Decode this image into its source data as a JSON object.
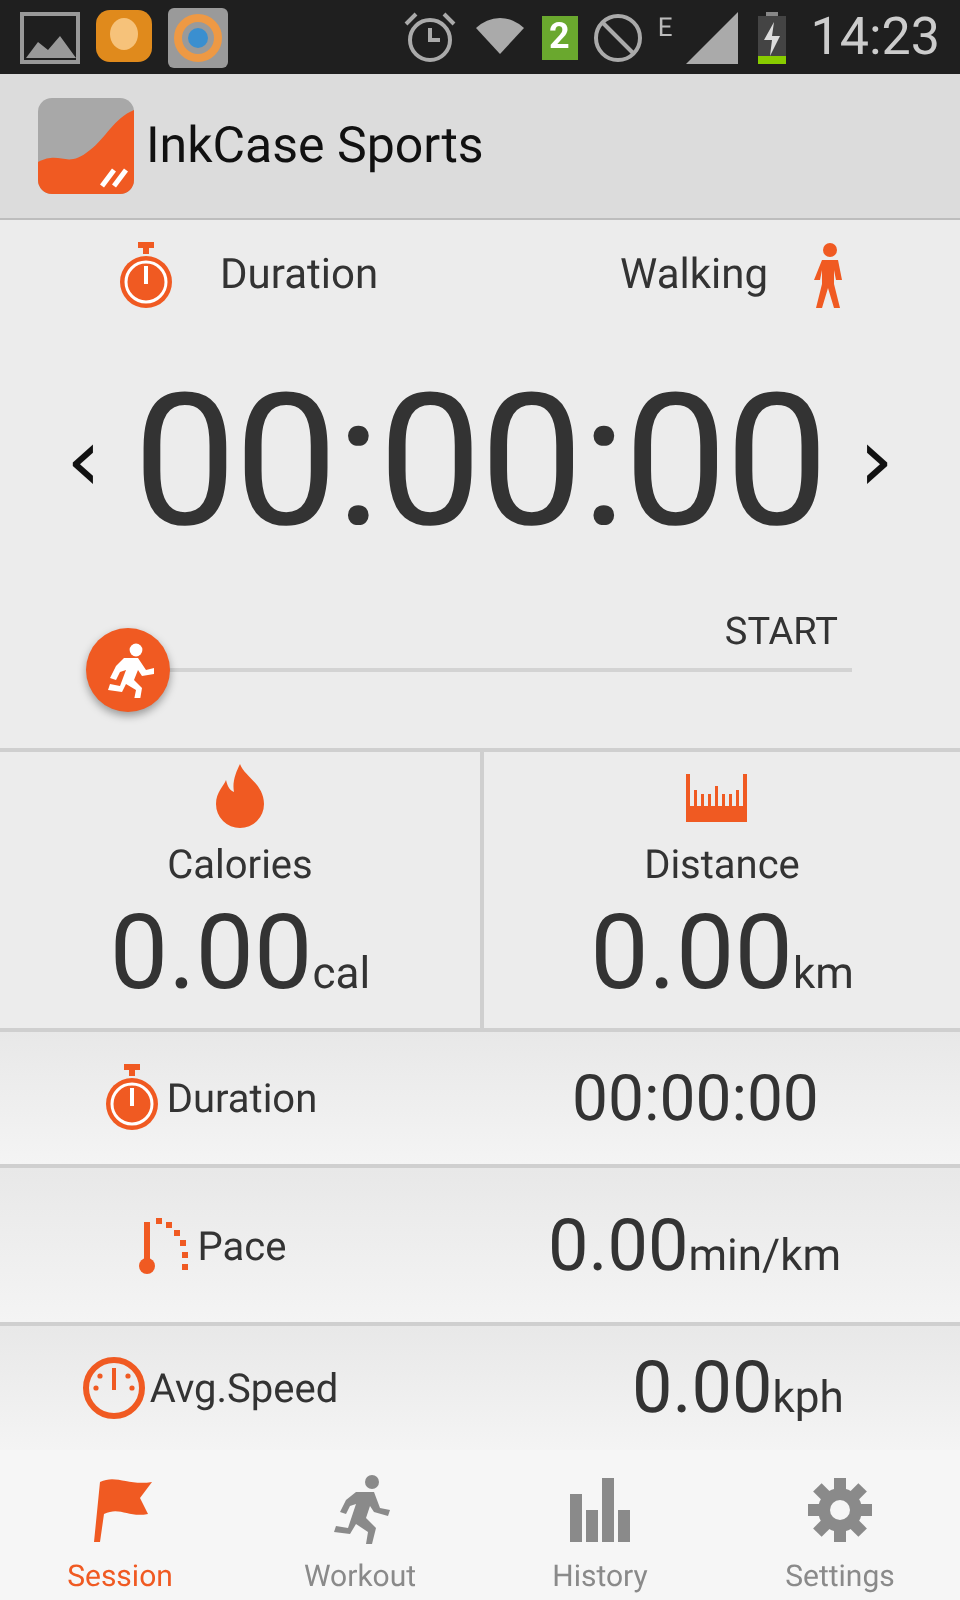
{
  "status_bar": {
    "sim_badge": "2",
    "network": "E",
    "time": "14:23"
  },
  "app_bar": {
    "title": "InkCase Sports"
  },
  "session": {
    "mode_label": "Duration",
    "activity": "Walking",
    "timer": "00:00:00",
    "prev": "‹",
    "next": "›",
    "slider_label": "START"
  },
  "stats": [
    {
      "kind": "calories",
      "label": "Calories",
      "value": "0.00",
      "unit": "cal"
    },
    {
      "kind": "distance",
      "label": "Distance",
      "value": "0.00",
      "unit": "km"
    }
  ],
  "metrics": [
    {
      "kind": "duration",
      "label": "Duration",
      "value": "00:00:00"
    },
    {
      "kind": "pace",
      "label": "Pace",
      "value": "0.00",
      "unit": "min/km"
    },
    {
      "kind": "speed",
      "label": "Avg.Speed",
      "value": "0.00",
      "unit": "kph"
    }
  ],
  "tabs": [
    {
      "kind": "flag",
      "label": "Session",
      "selected": true
    },
    {
      "kind": "runner",
      "label": "Workout",
      "selected": false
    },
    {
      "kind": "bars",
      "label": "History",
      "selected": false
    },
    {
      "kind": "gear",
      "label": "Settings",
      "selected": false
    }
  ]
}
